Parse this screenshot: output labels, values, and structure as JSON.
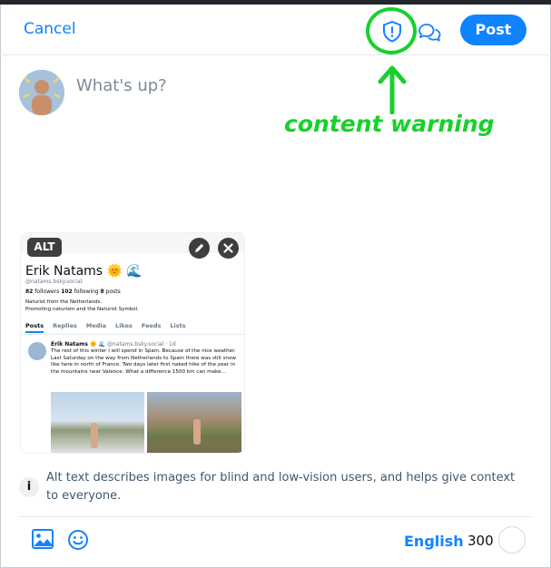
{
  "header": {
    "cancel_label": "Cancel",
    "post_label": "Post",
    "content_warning_icon": "shield-exclamation-icon",
    "thread_icon": "chat-bubbles-icon"
  },
  "annotation": {
    "text": "content warning",
    "color": "#17d12a"
  },
  "composer": {
    "placeholder": "What's up?"
  },
  "attachment": {
    "alt_label": "ALT",
    "screenshot": {
      "name": "Erik Natams 🌞 🌊",
      "handle": "@natams.bsky.social",
      "followers": "82",
      "followers_label": "followers",
      "following": "102",
      "following_label": "following",
      "posts": "8",
      "posts_label": "posts",
      "bio_line1": "Naturist from the Netherlands.",
      "bio_line2": "Promoting naturism and the Naturist Symbol.",
      "tabs": [
        "Posts",
        "Replies",
        "Media",
        "Likes",
        "Feeds",
        "Lists"
      ],
      "post_author": "Erik Natams 🌞 🌊",
      "post_meta": "@natams.bsky.social · 1d",
      "post_text": "The rest of this winter I will spend in Spain. Because of the nice weather. Last Saturday on the way from Netherlands to Spain there was still snow like here in north of France. Two days later first naked hike of the year in the mountains near Valence. What a difference 1500 km can make..."
    }
  },
  "info": {
    "text": "Alt text describes images for blind and low-vision users, and helps give context to everyone."
  },
  "footer": {
    "language": "English",
    "char_count": "300"
  },
  "colors": {
    "accent": "#1083fe",
    "annotation": "#17d12a"
  }
}
